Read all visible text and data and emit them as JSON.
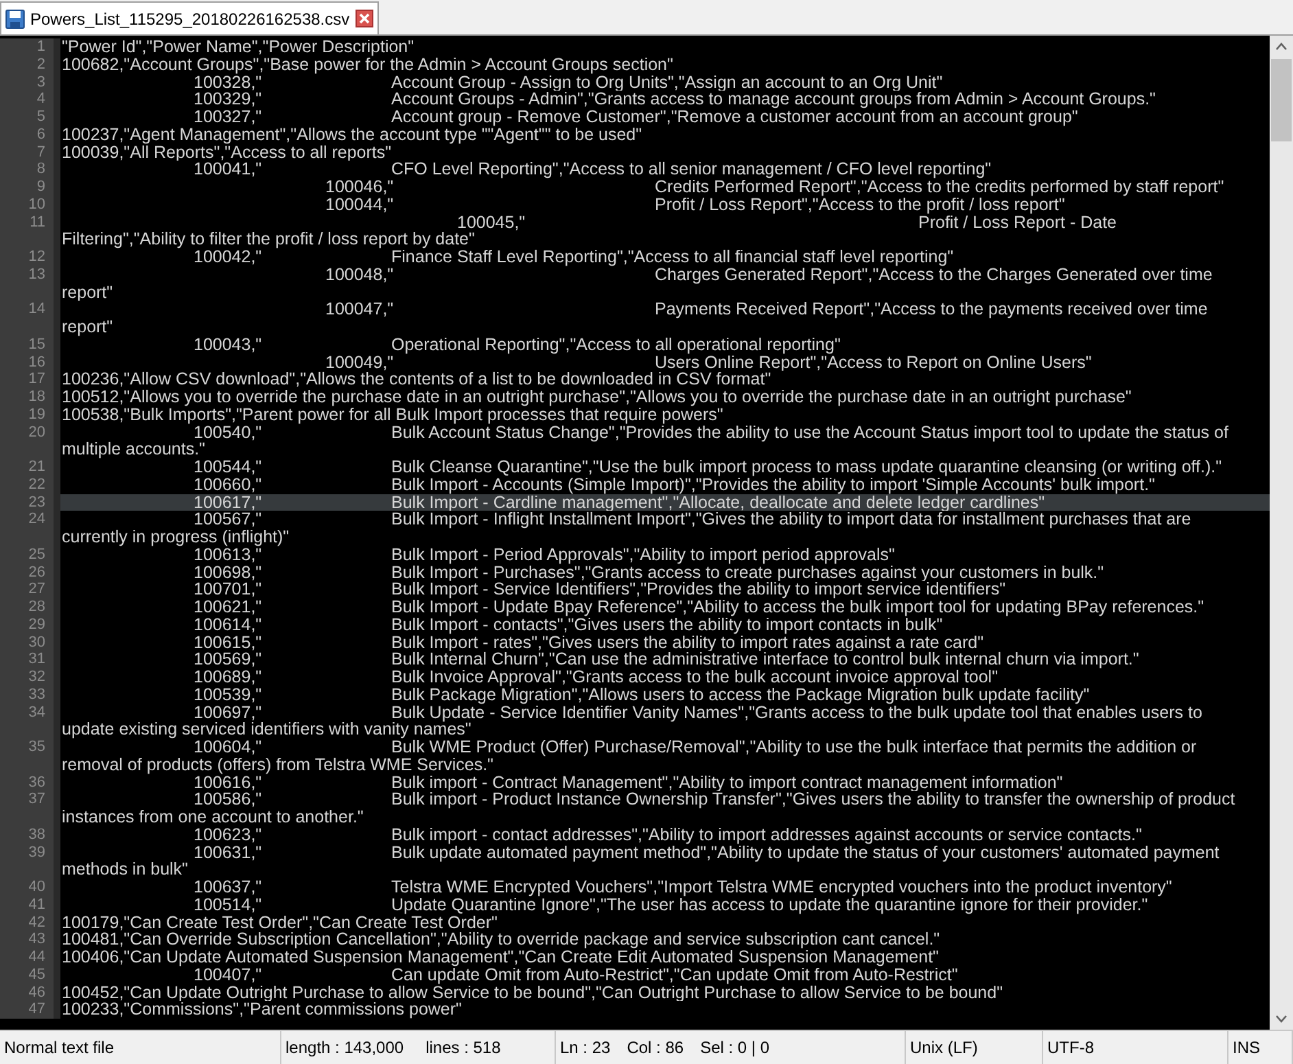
{
  "tab": {
    "title": "Powers_List_115295_20180226162538.csv",
    "selected": true
  },
  "editor": {
    "lines": [
      {
        "number": "1",
        "text": "\"Power Id\",\"Power Name\",\"Power Description\"",
        "selected": false
      },
      {
        "number": "2",
        "text": "100682,\"Account Groups\",\"Base power for the Admin > Account Groups section\"",
        "selected": false
      },
      {
        "number": "3",
        "text": "\t\t100328,\"\t\tAccount Group - Assign to Org Units\",\"Assign an account to an Org Unit\"",
        "selected": false
      },
      {
        "number": "4",
        "text": "\t\t100329,\"\t\tAccount Groups - Admin\",\"Grants access to manage account groups from Admin > Account Groups.\"",
        "selected": false
      },
      {
        "number": "5",
        "text": "\t\t100327,\"\t\tAccount group - Remove Customer\",\"Remove a customer account from an account group\"",
        "selected": false
      },
      {
        "number": "6",
        "text": "100237,\"Agent Management\",\"Allows the account type \"\"Agent\"\" to be used\"",
        "selected": false
      },
      {
        "number": "7",
        "text": "100039,\"All Reports\",\"Access to all reports\"",
        "selected": false
      },
      {
        "number": "8",
        "text": "\t\t100041,\"\t\tCFO Level Reporting\",\"Access to all senior management / CFO level reporting\"",
        "selected": false
      },
      {
        "number": "9",
        "text": "\t\t\t\t100046,\"\t\t\t\tCredits Performed Report\",\"Access to the credits performed by staff report\"",
        "selected": false
      },
      {
        "number": "10",
        "text": "\t\t\t\t100044,\"\t\t\t\tProfit / Loss Report\",\"Access to the profit / loss report\"",
        "selected": false
      },
      {
        "number": "11",
        "text": "\t\t\t\t\t\t100045,\"\t\t\t\t\t\tProfit / Loss Report - Date Filtering\",\"Ability to filter the profit / loss report by date\"",
        "selected": false
      },
      {
        "number": "12",
        "text": "\t\t100042,\"\t\tFinance Staff Level Reporting\",\"Access to all financial staff level reporting\"",
        "selected": false
      },
      {
        "number": "13",
        "text": "\t\t\t\t100048,\"\t\t\t\tCharges Generated Report\",\"Access to the Charges Generated over time report\"",
        "selected": false
      },
      {
        "number": "14",
        "text": "\t\t\t\t100047,\"\t\t\t\tPayments Received Report\",\"Access to the payments received over time report\"",
        "selected": false
      },
      {
        "number": "15",
        "text": "\t\t100043,\"\t\tOperational Reporting\",\"Access to all operational reporting\"",
        "selected": false
      },
      {
        "number": "16",
        "text": "\t\t\t\t100049,\"\t\t\t\tUsers Online Report\",\"Access to Report on Online Users\"",
        "selected": false
      },
      {
        "number": "17",
        "text": "100236,\"Allow CSV download\",\"Allows the contents of a list to be downloaded in CSV format\"",
        "selected": false
      },
      {
        "number": "18",
        "text": "100512,\"Allows you to override the purchase date in an outright purchase\",\"Allows you to override the purchase date in an outright purchase\"",
        "selected": false
      },
      {
        "number": "19",
        "text": "100538,\"Bulk Imports\",\"Parent power for all Bulk Import processes that require powers\"",
        "selected": false
      },
      {
        "number": "20",
        "text": "\t\t100540,\"\t\tBulk Account Status Change\",\"Provides the ability to use the Account Status import tool to update the status of multiple accounts.\"",
        "selected": false
      },
      {
        "number": "21",
        "text": "\t\t100544,\"\t\tBulk Cleanse Quarantine\",\"Use the bulk import process to mass update quarantine cleansing (or writing off.).\"",
        "selected": false
      },
      {
        "number": "22",
        "text": "\t\t100660,\"\t\tBulk Import - Accounts (Simple Import)\",\"Provides the ability to import 'Simple Accounts' bulk import.\"",
        "selected": false
      },
      {
        "number": "23",
        "text": "\t\t100617,\"\t\tBulk Import - Cardline management\",\"Allocate, deallocate and delete ledger cardlines\"",
        "selected": true
      },
      {
        "number": "24",
        "text": "\t\t100567,\"\t\tBulk Import - Inflight Installment Import\",\"Gives the ability to import data for installment purchases that are currently in progress (inflight)\"",
        "selected": false
      },
      {
        "number": "25",
        "text": "\t\t100613,\"\t\tBulk Import - Period Approvals\",\"Ability to import period approvals\"",
        "selected": false
      },
      {
        "number": "26",
        "text": "\t\t100698,\"\t\tBulk Import - Purchases\",\"Grants access to create purchases against your customers in bulk.\"",
        "selected": false
      },
      {
        "number": "27",
        "text": "\t\t100701,\"\t\tBulk Import - Service Identifiers\",\"Provides the ability to import service identifiers\"",
        "selected": false
      },
      {
        "number": "28",
        "text": "\t\t100621,\"\t\tBulk Import - Update Bpay Reference\",\"Ability to access the bulk import tool for updating BPay references.\"",
        "selected": false
      },
      {
        "number": "29",
        "text": "\t\t100614,\"\t\tBulk Import - contacts\",\"Gives users the ability to import contacts in bulk\"",
        "selected": false
      },
      {
        "number": "30",
        "text": "\t\t100615,\"\t\tBulk Import - rates\",\"Gives users the ability to import rates against a rate card\"",
        "selected": false
      },
      {
        "number": "31",
        "text": "\t\t100569,\"\t\tBulk Internal Churn\",\"Can use the administrative interface to control bulk internal churn via import.\"",
        "selected": false
      },
      {
        "number": "32",
        "text": "\t\t100689,\"\t\tBulk Invoice Approval\",\"Grants access to the bulk account invoice approval tool\"",
        "selected": false
      },
      {
        "number": "33",
        "text": "\t\t100539,\"\t\tBulk Package Migration\",\"Allows users to access the Package Migration bulk update facility\"",
        "selected": false
      },
      {
        "number": "34",
        "text": "\t\t100697,\"\t\tBulk Update - Service Identifier Vanity Names\",\"Grants access to the bulk update tool that enables users to update existing serviced identifiers with vanity names\"",
        "selected": false
      },
      {
        "number": "35",
        "text": "\t\t100604,\"\t\tBulk WME Product (Offer) Purchase/Removal\",\"Ability to use the bulk interface that permits the addition or removal of products (offers) from Telstra WME Services.\"",
        "selected": false
      },
      {
        "number": "36",
        "text": "\t\t100616,\"\t\tBulk import - Contract Management\",\"Ability to import contract management information\"",
        "selected": false
      },
      {
        "number": "37",
        "text": "\t\t100586,\"\t\tBulk import - Product Instance Ownership Transfer\",\"Gives users the ability to transfer the ownership of product instances from one account to another.\"",
        "selected": false
      },
      {
        "number": "38",
        "text": "\t\t100623,\"\t\tBulk import - contact addresses\",\"Ability to import addresses against accounts or service contacts.\"",
        "selected": false
      },
      {
        "number": "39",
        "text": "\t\t100631,\"\t\tBulk update automated payment method\",\"Ability to update the status of your customers' automated payment methods in bulk\"",
        "selected": false
      },
      {
        "number": "40",
        "text": "\t\t100637,\"\t\tTelstra WME Encrypted Vouchers\",\"Import Telstra WME encrypted vouchers into the product inventory\"",
        "selected": false
      },
      {
        "number": "41",
        "text": "\t\t100514,\"\t\tUpdate Quarantine Ignore\",\"The user has access to update the quarantine ignore for their provider.\"",
        "selected": false
      },
      {
        "number": "42",
        "text": "100179,\"Can Create Test Order\",\"Can Create Test Order\"",
        "selected": false
      },
      {
        "number": "43",
        "text": "100481,\"Can Override Subscription Cancellation\",\"Ability to override package and service subscription cant cancel.\"",
        "selected": false
      },
      {
        "number": "44",
        "text": "100406,\"Can Update Automated Suspension Management\",\"Can Create Edit Automated Suspension Management\"",
        "selected": false
      },
      {
        "number": "45",
        "text": "\t\t100407,\"\t\tCan update Omit from Auto-Restrict\",\"Can update Omit from Auto-Restrict\"",
        "selected": false
      },
      {
        "number": "46",
        "text": "100452,\"Can Update Outright Purchase to allow Service to be bound\",\"Can Outright Purchase to allow Service to be bound\"",
        "selected": false
      },
      {
        "number": "47",
        "text": "100233,\"Commissions\",\"Parent commissions power\"",
        "selected": false
      }
    ]
  },
  "status_bar": {
    "file_type": "Normal text file",
    "length": "length : 143,000",
    "lines": "lines : 518",
    "ln": "Ln : 23",
    "col": "Col : 86",
    "sel": "Sel : 0 | 0",
    "eol": "Unix (LF)",
    "encoding": "UTF-8",
    "mode": "INS"
  }
}
